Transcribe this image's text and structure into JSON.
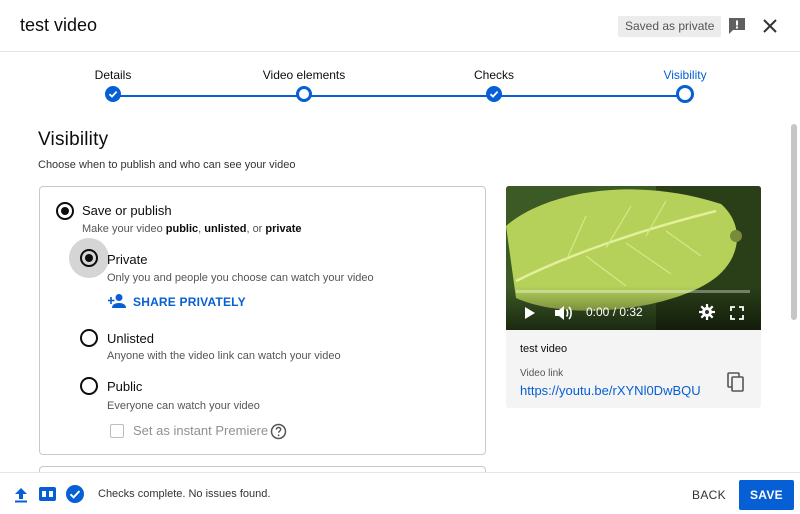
{
  "header": {
    "title": "test video",
    "saved_badge": "Saved as private",
    "icons": {
      "feedback": "feedback-icon",
      "close": "close-icon"
    }
  },
  "stepper": {
    "steps": [
      {
        "label": "Details",
        "state": "done"
      },
      {
        "label": "Video elements",
        "state": "current-visited"
      },
      {
        "label": "Checks",
        "state": "done"
      },
      {
        "label": "Visibility",
        "state": "active"
      }
    ],
    "accent_color": "#065fd4"
  },
  "visibility": {
    "heading": "Visibility",
    "subheading": "Choose when to publish and who can see your video",
    "save_or_publish": {
      "title": "Save or publish",
      "desc_prefix": "Make your video ",
      "desc_public": "public",
      "desc_sep1": ", ",
      "desc_unlisted": "unlisted",
      "desc_sep2": ", or ",
      "desc_private": "private",
      "selected": true
    },
    "options": [
      {
        "title": "Private",
        "desc": "Only you and people you choose can watch your video",
        "selected": true
      },
      {
        "title": "Unlisted",
        "desc": "Anyone with the video link can watch your video",
        "selected": false
      },
      {
        "title": "Public",
        "desc": "Everyone can watch your video",
        "selected": false
      }
    ],
    "share_privately": "SHARE PRIVATELY",
    "instant_premiere": {
      "label": "Set as instant Premiere",
      "checked": false
    }
  },
  "preview": {
    "time": "0:00 / 0:32",
    "progress": 0.0,
    "video_title": "test video",
    "link_label": "Video link",
    "link_value": "https://youtu.be/rXYNl0DwBQU"
  },
  "footer": {
    "status": "Checks complete. No issues found.",
    "back_label": "BACK",
    "save_label": "SAVE"
  }
}
